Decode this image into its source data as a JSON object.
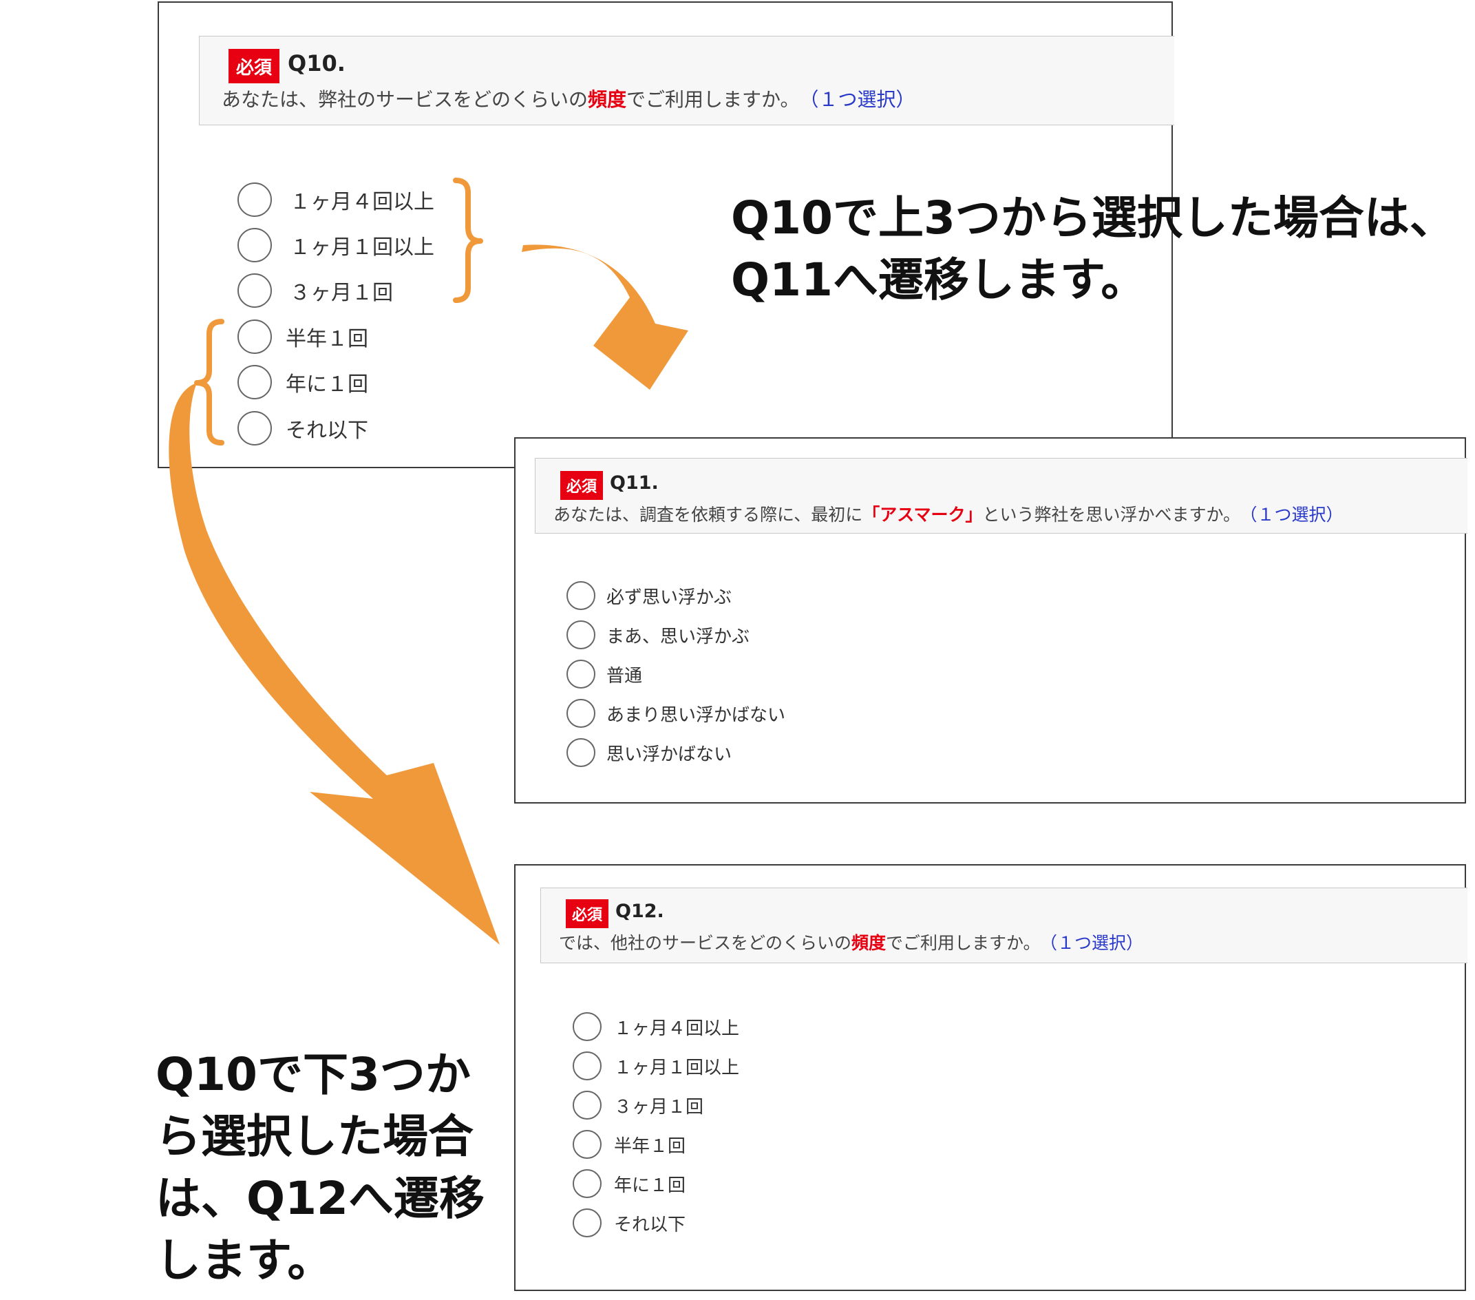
{
  "badge_label": "必須",
  "q10": {
    "number": "Q10.",
    "text_before": "あなたは、弊社のサービスをどのくらいの",
    "text_emph": "頻度",
    "text_after": "でご利用しますか。",
    "hint": "（１つ選択）",
    "options": [
      "１ヶ月４回以上",
      "１ヶ月１回以上",
      "３ヶ月１回",
      "半年１回",
      "年に１回",
      "それ以下"
    ]
  },
  "q11": {
    "number": "Q11.",
    "text_before": "あなたは、調査を依頼する際に、最初に",
    "text_emph": "「アスマーク」",
    "text_after": "という弊社を思い浮かべますか。",
    "hint": "（１つ選択）",
    "options": [
      "必ず思い浮かぶ",
      "まあ、思い浮かぶ",
      "普通",
      "あまり思い浮かばない",
      "思い浮かばない"
    ]
  },
  "q12": {
    "number": "Q12.",
    "text_before": "では、他社のサービスをどのくらいの",
    "text_emph": "頻度",
    "text_after": "でご利用しますか。",
    "hint": "（１つ選択）",
    "options": [
      "１ヶ月４回以上",
      "１ヶ月１回以上",
      "３ヶ月１回",
      "半年１回",
      "年に１回",
      "それ以下"
    ]
  },
  "callout_top": {
    "line1": "Q10で上3つから選択した場合は、",
    "line2": "Q11へ遷移します。"
  },
  "callout_bottom": {
    "line1": "Q10で下3つか",
    "line2": "ら選択した場合",
    "line3": "は、Q12へ遷移",
    "line4": "します。"
  },
  "colors": {
    "badge": "#e60012",
    "emphasis": "#e60012",
    "hint": "#2838c8",
    "arrow": "#f0993a",
    "border": "#3a3a3a"
  }
}
